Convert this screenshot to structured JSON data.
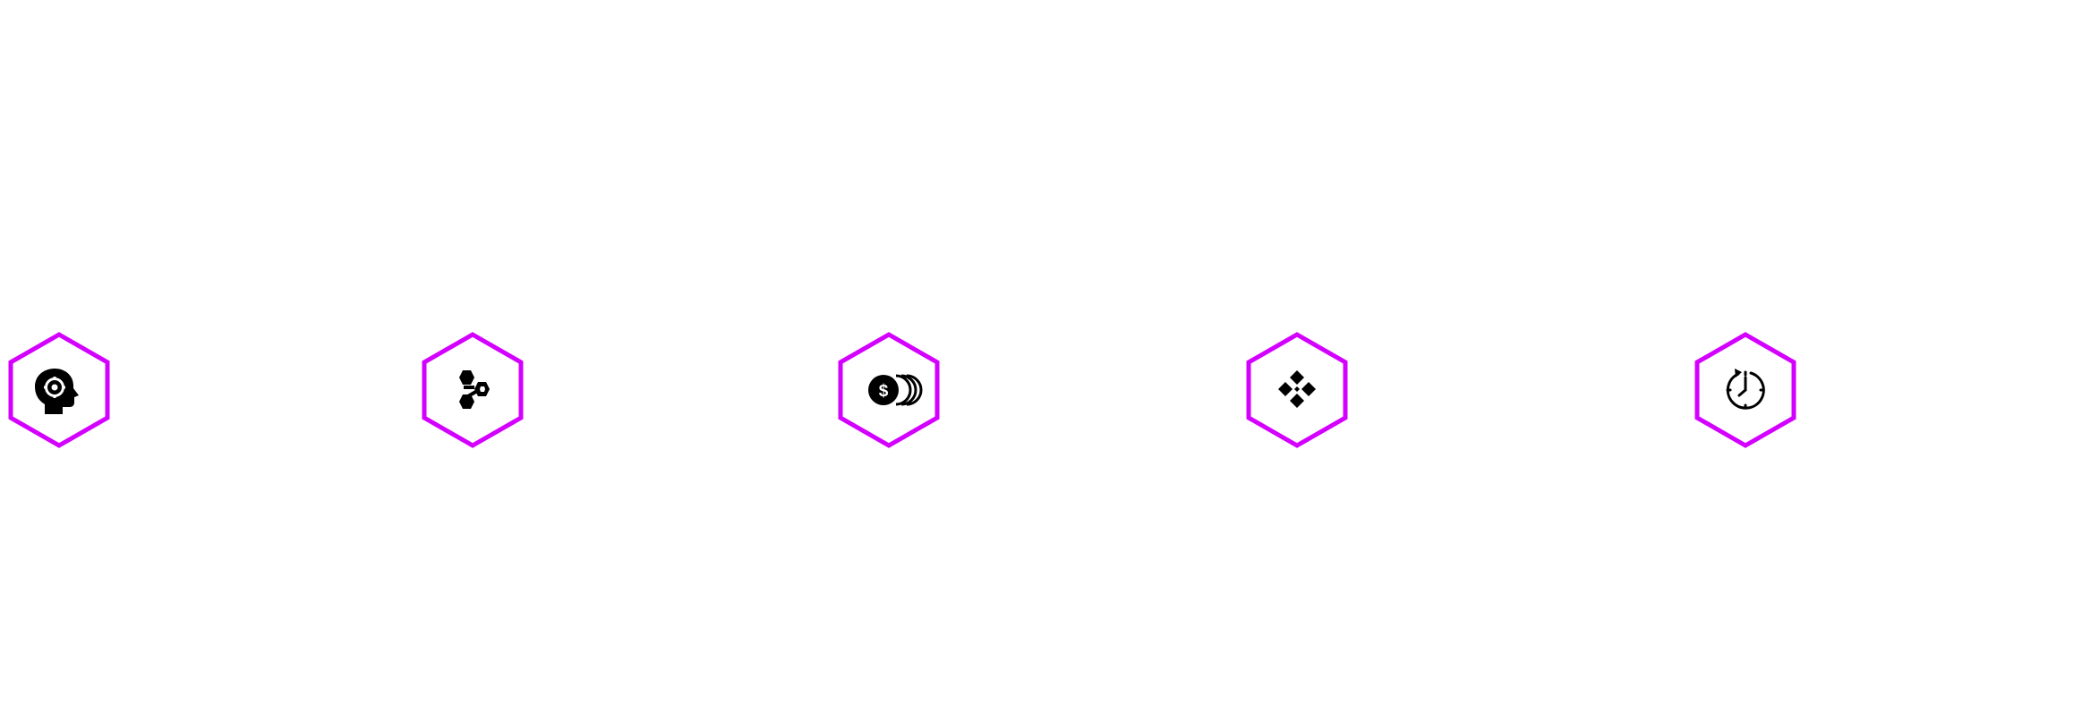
{
  "accent_color": "#D400FF",
  "icon_color": "#000000",
  "background_color": "#FFFFFF",
  "icons": [
    {
      "name": "head-gear-icon"
    },
    {
      "name": "hexagon-network-icon"
    },
    {
      "name": "dollar-coins-icon"
    },
    {
      "name": "diamond-grid-icon"
    },
    {
      "name": "stopwatch-icon"
    }
  ]
}
